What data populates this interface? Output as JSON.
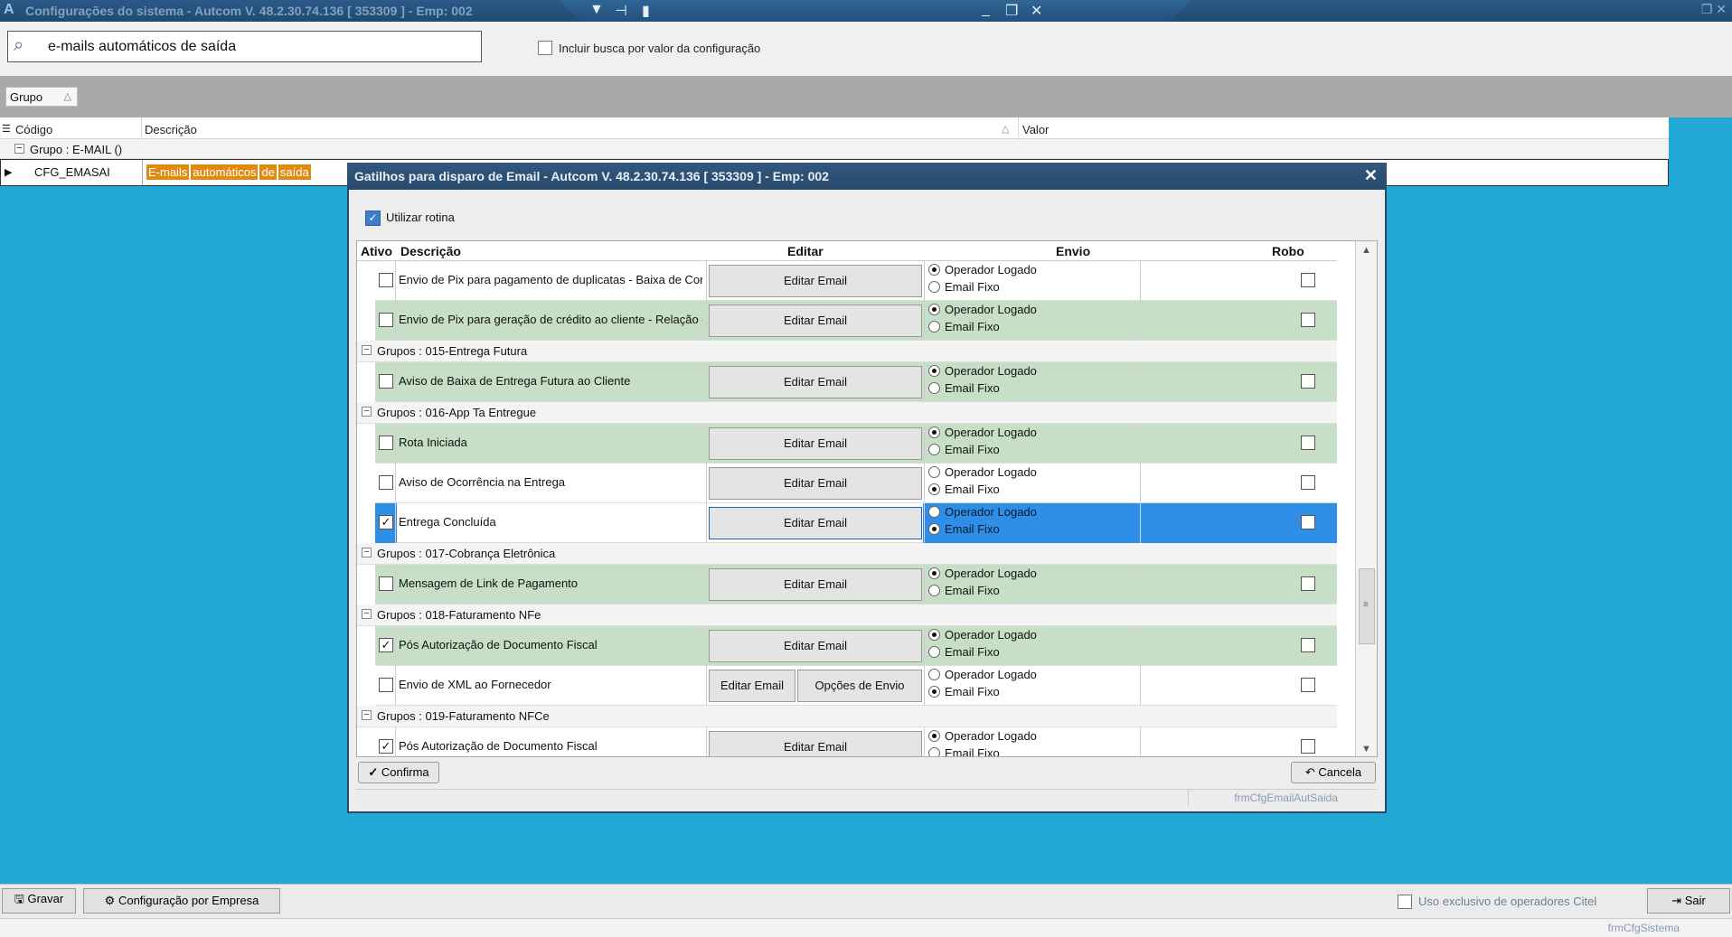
{
  "window": {
    "title": "Configurações do sistema  -  Autcom V. 48.2.30.74.136 [ 353309 ] - Emp: 002"
  },
  "search": {
    "value": "e-mails automáticos de saída",
    "include_label": "Incluir busca por valor da configuração"
  },
  "grid": {
    "group_button": "Grupo",
    "columns": [
      "Código",
      "Descrição",
      "Valor"
    ],
    "group_row": "Grupo : E-MAIL ()",
    "row_code": "CFG_EMASAI",
    "row_desc_words": [
      "E-mails",
      "automáticos",
      "de",
      "saída"
    ]
  },
  "dialog": {
    "title": "Gatilhos para disparo de Email  -  Autcom V. 48.2.30.74.136 [ 353309 ] - Emp: 002",
    "use_routine_label": "Utilizar rotina",
    "headers": {
      "ativo": "Ativo",
      "descricao": "Descrição",
      "editar": "Editar",
      "envio": "Envio",
      "robo": "Robo"
    },
    "radio_labels": {
      "op": "Operador Logado",
      "fixo": "Email Fixo"
    },
    "edit_label": "Editar Email",
    "options_label": "Opções de Envio",
    "rows": [
      {
        "kind": "item",
        "desc": "Envio de Pix para pagamento de duplicatas - Baixa de Contas a Receb",
        "checked": false,
        "send": "op",
        "bg": "white"
      },
      {
        "kind": "item",
        "desc": "Envio de Pix para geração de crédito ao cliente - Relação de Documen",
        "checked": false,
        "send": "op",
        "bg": "green"
      },
      {
        "kind": "group",
        "label": "Grupos : 015-Entrega Futura"
      },
      {
        "kind": "item",
        "desc": "Aviso de Baixa de Entrega Futura ao Cliente",
        "checked": false,
        "send": "op",
        "bg": "green"
      },
      {
        "kind": "group",
        "label": "Grupos : 016-App Ta Entregue"
      },
      {
        "kind": "item",
        "desc": "Rota Iniciada",
        "checked": false,
        "send": "op",
        "bg": "green"
      },
      {
        "kind": "item",
        "desc": "Aviso de Ocorrência na Entrega",
        "checked": false,
        "send": "fixo",
        "bg": "white"
      },
      {
        "kind": "item",
        "desc": "Entrega Concluída",
        "checked": true,
        "send": "fixo",
        "bg": "sel"
      },
      {
        "kind": "group",
        "label": "Grupos : 017-Cobrança Eletrônica"
      },
      {
        "kind": "item",
        "desc": "Mensagem de Link de Pagamento",
        "checked": false,
        "send": "op",
        "bg": "green"
      },
      {
        "kind": "group",
        "label": "Grupos : 018-Faturamento NFe"
      },
      {
        "kind": "item",
        "desc": "Pós Autorização de Documento Fiscal",
        "checked": true,
        "send": "op",
        "bg": "green"
      },
      {
        "kind": "item",
        "desc": "Envio de XML ao Fornecedor",
        "checked": false,
        "send": "fixo",
        "bg": "white",
        "options": true
      },
      {
        "kind": "group",
        "label": "Grupos : 019-Faturamento NFCe"
      },
      {
        "kind": "item",
        "desc": "Pós Autorização de Documento Fiscal",
        "checked": true,
        "send": "op",
        "bg": "white"
      }
    ],
    "confirm_label": "Confirma",
    "cancel_label": "Cancela",
    "form_name": "frmCfgEmailAutSaida"
  },
  "bottom": {
    "save_label": "Gravar",
    "company_cfg_label": "Configuração por Empresa",
    "exclusive_label": "Uso exclusivo de operadores Citel",
    "exit_label": "Sair",
    "form_name": "frmCfgSistema"
  },
  "colors": {
    "desktop": "#23a7d4",
    "row_green": "#c7dfc6",
    "selection": "#2f8fe8",
    "highlight": "#e08a12"
  }
}
